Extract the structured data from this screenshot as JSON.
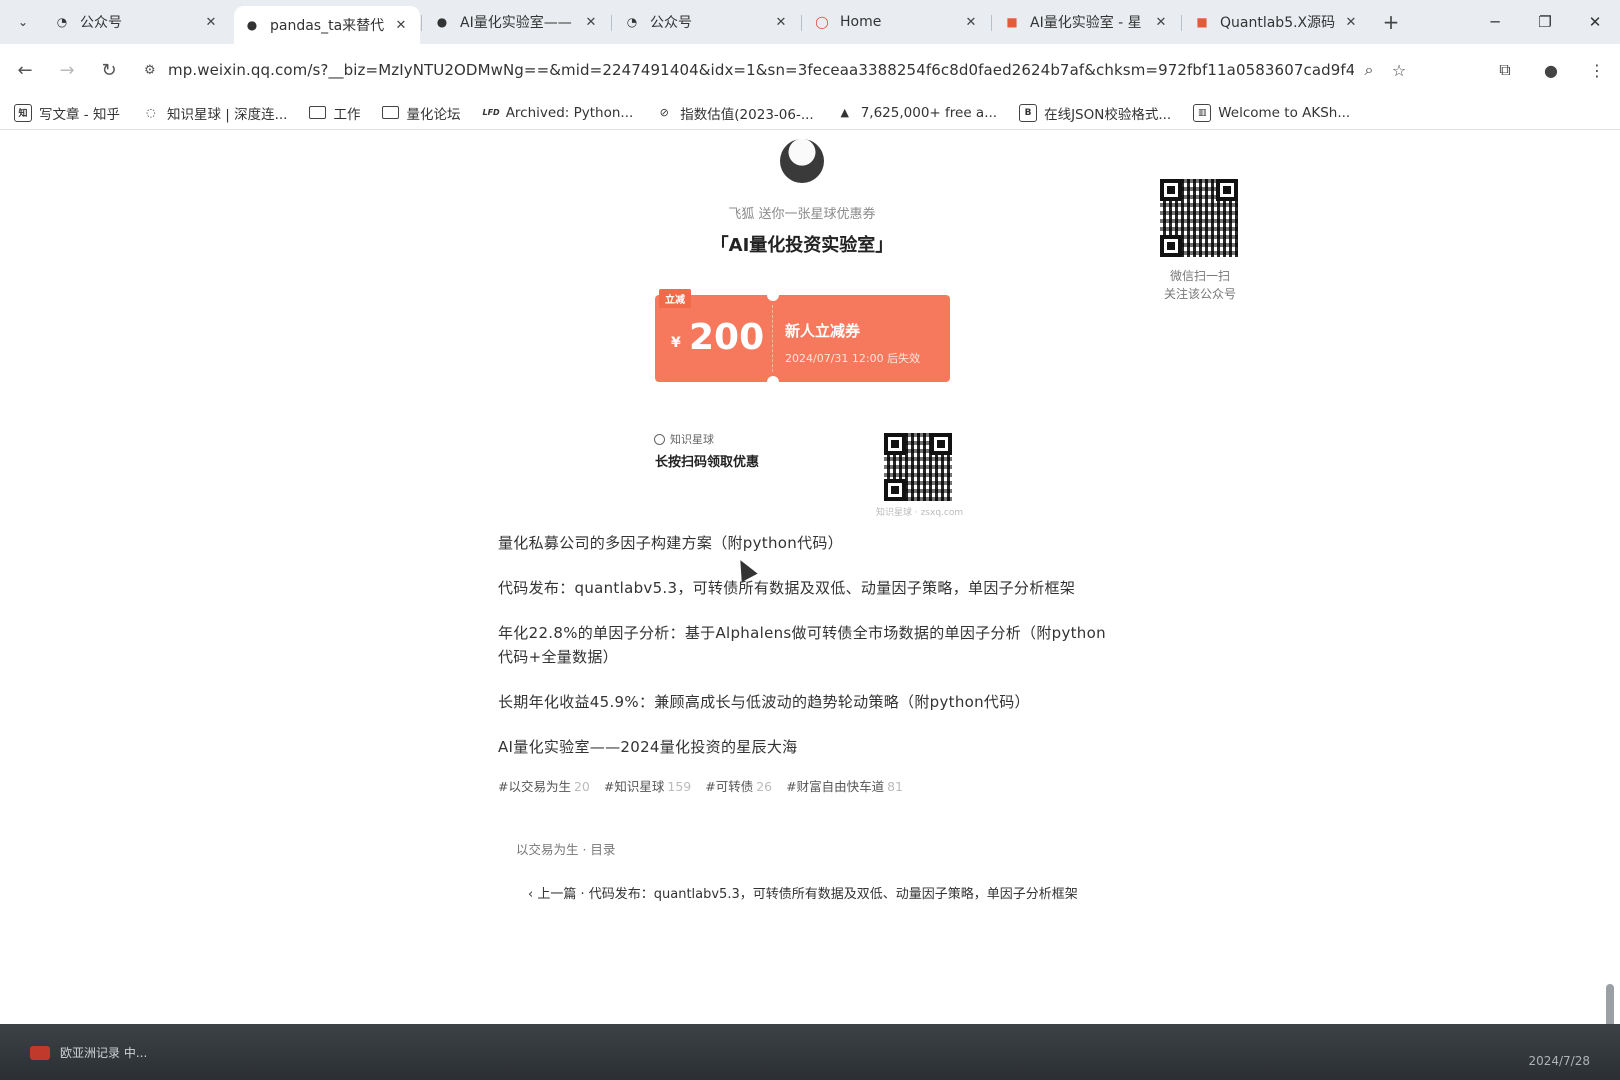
{
  "tabs": [
    {
      "title": "公众号",
      "icon": "wechat-mp-icon",
      "active": false
    },
    {
      "title": "pandas_ta来替代",
      "icon": "wechat-icon",
      "active": true
    },
    {
      "title": "AI量化实验室——",
      "icon": "wechat-icon",
      "active": false
    },
    {
      "title": "公众号",
      "icon": "wechat-mp-icon",
      "active": false
    },
    {
      "title": "Home",
      "icon": "home-site-icon",
      "active": false
    },
    {
      "title": "AI量化实验室 - 星",
      "icon": "zsxq-icon",
      "active": false
    },
    {
      "title": "Quantlab5.X源码",
      "icon": "zsxq-icon",
      "active": false
    }
  ],
  "address": {
    "url": "mp.weixin.qq.com/s?__biz=MzIyNTU2ODMwNg==&mid=2247491404&idx=1&sn=3feceaa3388254f6c8d0faed2624b7af&chksm=972fbf11a0583607cad9f49..."
  },
  "bookmarks": [
    {
      "label": "写文章 - 知乎",
      "icon": "zhihu-icon"
    },
    {
      "label": "知识星球 | 深度连...",
      "icon": "zsxq-icon"
    },
    {
      "label": "工作",
      "icon": "folder-icon"
    },
    {
      "label": "量化论坛",
      "icon": "folder-icon"
    },
    {
      "label": "Archived: Python...",
      "icon": "lfd-icon",
      "prefix": "LFD"
    },
    {
      "label": "指数估值(2023-06-...",
      "icon": "valuation-icon"
    },
    {
      "label": "7,625,000+ free a...",
      "icon": "free-assets-icon"
    },
    {
      "label": "在线JSON校验格式...",
      "icon": "json-icon"
    },
    {
      "label": "Welcome to AKSh...",
      "icon": "aksh-icon"
    }
  ],
  "promo": {
    "subtitle": "飞狐 送你一张星球优惠券",
    "title": "「AI量化投资实验室」",
    "coupon": {
      "tag": "立减",
      "currency": "¥",
      "amount": "200",
      "name": "新人立减券",
      "expiry": "2024/07/31 12:00 后失效"
    },
    "brand": "知识星球",
    "cta": "长按扫码领取优惠",
    "qr_caption": "知识星球 · zsxq.com"
  },
  "sidebar_qr": {
    "line1": "微信扫一扫",
    "line2": "关注该公众号"
  },
  "links": [
    "量化私募公司的多因子构建方案（附python代码）",
    "代码发布：quantlabv5.3，可转债所有数据及双低、动量因子策略，单因子分析框架",
    "年化22.8%的单因子分析：基于Alphalens做可转债全市场数据的单因子分析（附python代码+全量数据）",
    "长期年化收益45.9%：兼顾高成长与低波动的趋势轮动策略（附python代码）",
    "AI量化实验室——2024量化投资的星辰大海"
  ],
  "tags": [
    {
      "name": "#以交易为生",
      "count": "20"
    },
    {
      "name": "#知识星球",
      "count": "159"
    },
    {
      "name": "#可转债",
      "count": "26"
    },
    {
      "name": "#财富自由快车道",
      "count": "81"
    }
  ],
  "album": "以交易为生 · 目录",
  "prev_article": "上一篇 · 代码发布：quantlabv5.3，可转债所有数据及双低、动量因子策略，单因子分析框架",
  "taskbar": {
    "app_label": "欧亚洲记录 中...",
    "date": "2024/7/28"
  }
}
